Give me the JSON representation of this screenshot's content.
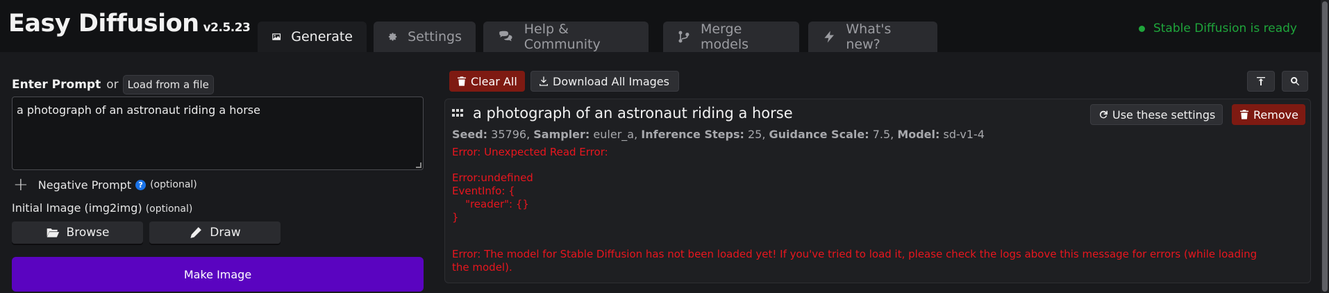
{
  "app": {
    "title": "Easy Diffusion",
    "version": "v2.5.23",
    "status": "Stable Diffusion is ready"
  },
  "tabs": [
    {
      "label": "Generate",
      "icon": "image-icon",
      "active": true
    },
    {
      "label": "Settings",
      "icon": "gear-icon",
      "active": false
    },
    {
      "label": "Help & Community",
      "icon": "comments-icon",
      "active": false
    },
    {
      "label": "Merge models",
      "icon": "code-branch-icon",
      "active": false
    },
    {
      "label": "What's new?",
      "icon": "bolt-icon",
      "active": false
    }
  ],
  "prompt": {
    "label": "Enter Prompt",
    "or": "or",
    "load_button": "Load from a file",
    "value": "a photograph of an astronaut riding a horse"
  },
  "negative": {
    "label": "Negative Prompt",
    "help": "?",
    "optional": "(optional)"
  },
  "init_image": {
    "label": "Initial Image (img2img)",
    "optional": "(optional)",
    "browse": "Browse",
    "draw": "Draw"
  },
  "make_button": "Make Image",
  "toolbar": {
    "clear_all": "Clear All",
    "download_all": "Download All Images"
  },
  "task": {
    "title": "a photograph of an astronaut riding a horse",
    "use_settings": "Use these settings",
    "remove": "Remove",
    "seed_label": "Seed:",
    "seed": "35796,",
    "sampler_label": "Sampler:",
    "sampler": "euler_a,",
    "steps_label": "Inference Steps:",
    "steps": "25,",
    "guidance_label": "Guidance Scale:",
    "guidance": "7.5,",
    "model_label": "Model:",
    "model": "sd-v1-4",
    "error1": "Error: Unexpected Read Error:",
    "error2": "Error:undefined\nEventInfo: {\n    \"reader\": {}\n}",
    "error3": "Error: The model for Stable Diffusion has not been loaded yet! If you've tried to load it, please check the logs above this message for errors (while loading\nthe model)."
  },
  "colors": {
    "accent": "#5a04c0",
    "ready": "#1fa53b",
    "error": "#e8161e",
    "danger_button": "#7e1a12"
  }
}
